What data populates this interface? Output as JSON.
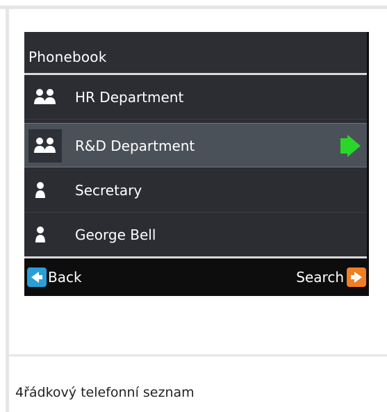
{
  "phonebook": {
    "title": "Phonebook",
    "items": [
      {
        "label": "HR Department",
        "icon": "group-icon",
        "selected": false
      },
      {
        "label": "R&D Department",
        "icon": "group-icon",
        "selected": true
      },
      {
        "label": "Secretary",
        "icon": "contact-icon",
        "selected": false
      },
      {
        "label": "George Bell",
        "icon": "contact-icon",
        "selected": false
      }
    ]
  },
  "softkeys": {
    "back_label": "Back",
    "search_label": "Search"
  },
  "caption": "4řádkový telefonní seznam",
  "colors": {
    "screen_bg": "#2b2d33",
    "selected_bg": "#4b5158",
    "back_key": "#2a9fd6",
    "search_key": "#f07f22",
    "select_arrow": "#2bd62b"
  }
}
